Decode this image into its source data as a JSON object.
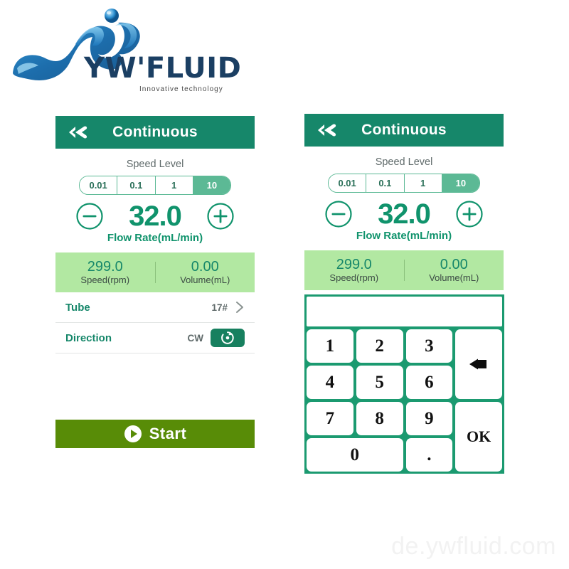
{
  "logo": {
    "wordmark": "YW'FLUID",
    "tagline": "Innovative technology",
    "icon": "water-wave-splash-icon"
  },
  "colors": {
    "header_green": "#16876a",
    "accent_green": "#10936c",
    "stats_bar_green": "#b2e8a2",
    "segment_selected": "#5cb995",
    "start_button_green": "#588c07",
    "keypad_frame_green": "#1b9a70",
    "direction_button_green": "#17805f",
    "logo_blue": "#1b3f63"
  },
  "panel_left": {
    "header": {
      "back_icon": "double-chevron-back-icon",
      "title": "Continuous"
    },
    "speed_level": {
      "label": "Speed Level",
      "options": [
        "0.01",
        "0.1",
        "1",
        "10"
      ],
      "selected": "10",
      "selected_index": 3
    },
    "flow_rate": {
      "minus_icon": "minus-circle-icon",
      "plus_icon": "plus-circle-icon",
      "value": "32.0",
      "unit_label": "Flow Rate(mL/min)"
    },
    "stats": [
      {
        "value": "299.0",
        "label": "Speed(rpm)"
      },
      {
        "value": "0.00",
        "label": "Volume(mL)"
      }
    ],
    "rows": [
      {
        "label": "Tube",
        "value": "17#",
        "icon": "chevron-right-icon"
      },
      {
        "label": "Direction",
        "value": "CW",
        "icon": "rotate-clockwise-icon"
      }
    ],
    "start_button": {
      "label": "Start",
      "icon": "play-circle-icon"
    }
  },
  "panel_right": {
    "header": {
      "back_icon": "double-chevron-back-icon",
      "title": "Continuous"
    },
    "speed_level": {
      "label": "Speed Level",
      "options": [
        "0.01",
        "0.1",
        "1",
        "10"
      ],
      "selected": "10",
      "selected_index": 3
    },
    "flow_rate": {
      "minus_icon": "minus-circle-icon",
      "plus_icon": "plus-circle-icon",
      "value": "32.0",
      "unit_label": "Flow Rate(mL/min)"
    },
    "stats": [
      {
        "value": "299.0",
        "label": "Speed(rpm)"
      },
      {
        "value": "0.00",
        "label": "Volume(mL)"
      }
    ],
    "keypad": {
      "display_value": "",
      "keys": [
        {
          "label": "1",
          "name": "key-1",
          "span": "normal"
        },
        {
          "label": "2",
          "name": "key-2",
          "span": "normal"
        },
        {
          "label": "3",
          "name": "key-3",
          "span": "normal"
        },
        {
          "label": "",
          "name": "key-backspace",
          "span": "tall",
          "icon": "backspace-left-arrow-icon"
        },
        {
          "label": "4",
          "name": "key-4",
          "span": "normal"
        },
        {
          "label": "5",
          "name": "key-5",
          "span": "normal"
        },
        {
          "label": "6",
          "name": "key-6",
          "span": "normal"
        },
        {
          "label": "7",
          "name": "key-7",
          "span": "normal"
        },
        {
          "label": "8",
          "name": "key-8",
          "span": "normal"
        },
        {
          "label": "9",
          "name": "key-9",
          "span": "normal"
        },
        {
          "label": "OK",
          "name": "key-ok",
          "span": "tall"
        },
        {
          "label": "0",
          "name": "key-0",
          "span": "wide"
        },
        {
          "label": ".",
          "name": "key-decimal",
          "span": "normal"
        }
      ]
    }
  },
  "watermark": "de.ywfluid.com"
}
